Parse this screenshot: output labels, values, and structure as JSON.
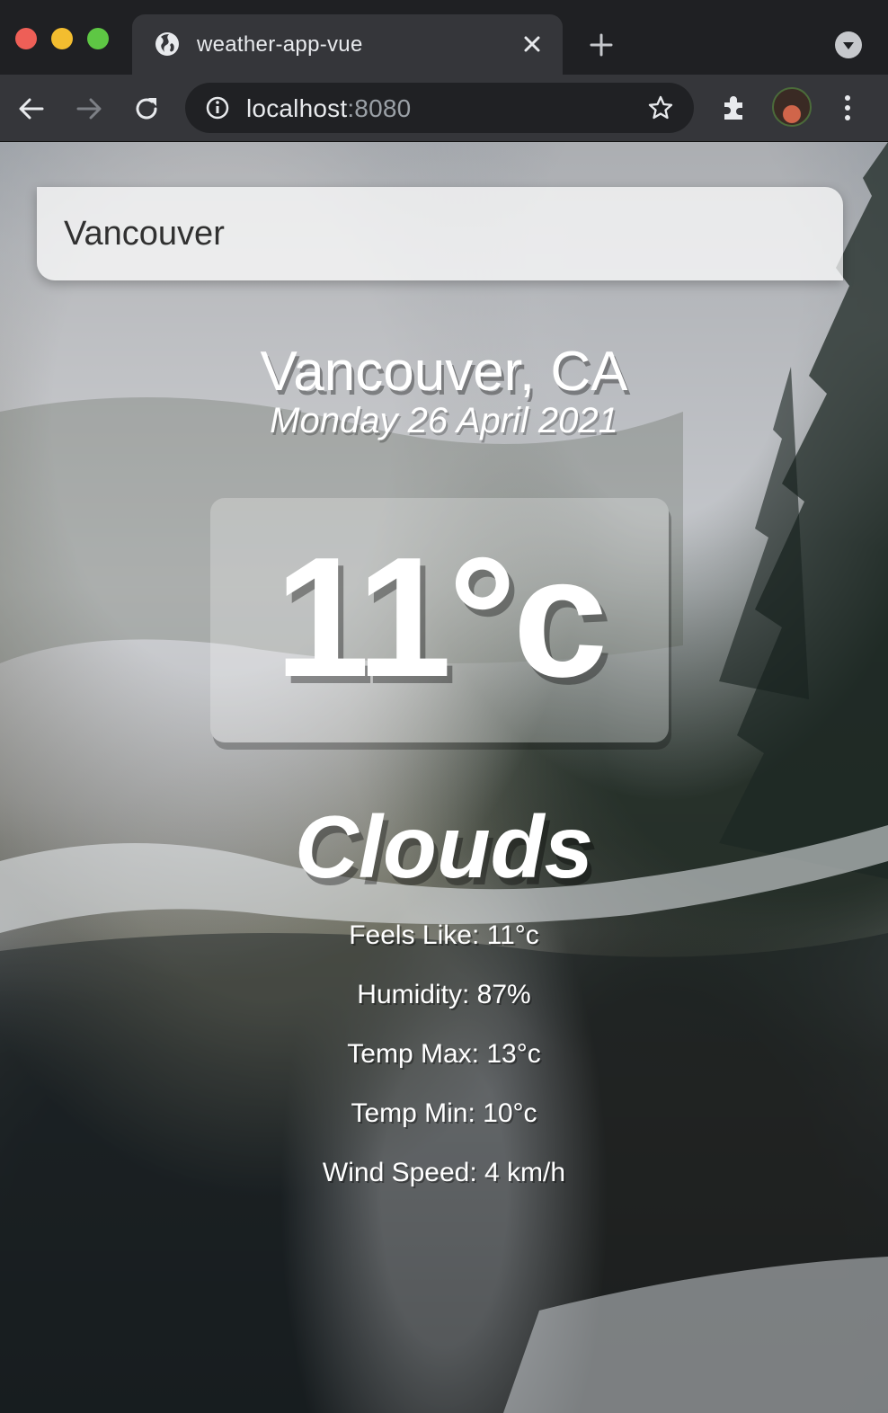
{
  "browser": {
    "tab_title": "weather-app-vue",
    "url_host": "localhost",
    "url_port": ":8080"
  },
  "icons": [
    "globe-icon",
    "close-icon",
    "plus-icon",
    "tab-search-icon",
    "back-arrow-icon",
    "forward-arrow-icon",
    "reload-icon",
    "info-icon",
    "star-icon",
    "extensions-icon",
    "avatar",
    "more-menu-icon"
  ],
  "app": {
    "search_value": "Vancouver",
    "location": "Vancouver, CA",
    "date": "Monday 26 April 2021",
    "temperature": "11°c",
    "weather": "Clouds",
    "details": {
      "feels_like": "Feels Like: 11°c",
      "humidity": "Humidity: 87%",
      "temp_max": "Temp Max: 13°c",
      "temp_min": "Temp Min: 10°c",
      "wind_speed": "Wind Speed: 4 km/h"
    }
  },
  "colors": {
    "text": "#ffffff",
    "search_text": "#313131",
    "chrome_dark": "#1f2023",
    "chrome_tab": "#35363a"
  }
}
